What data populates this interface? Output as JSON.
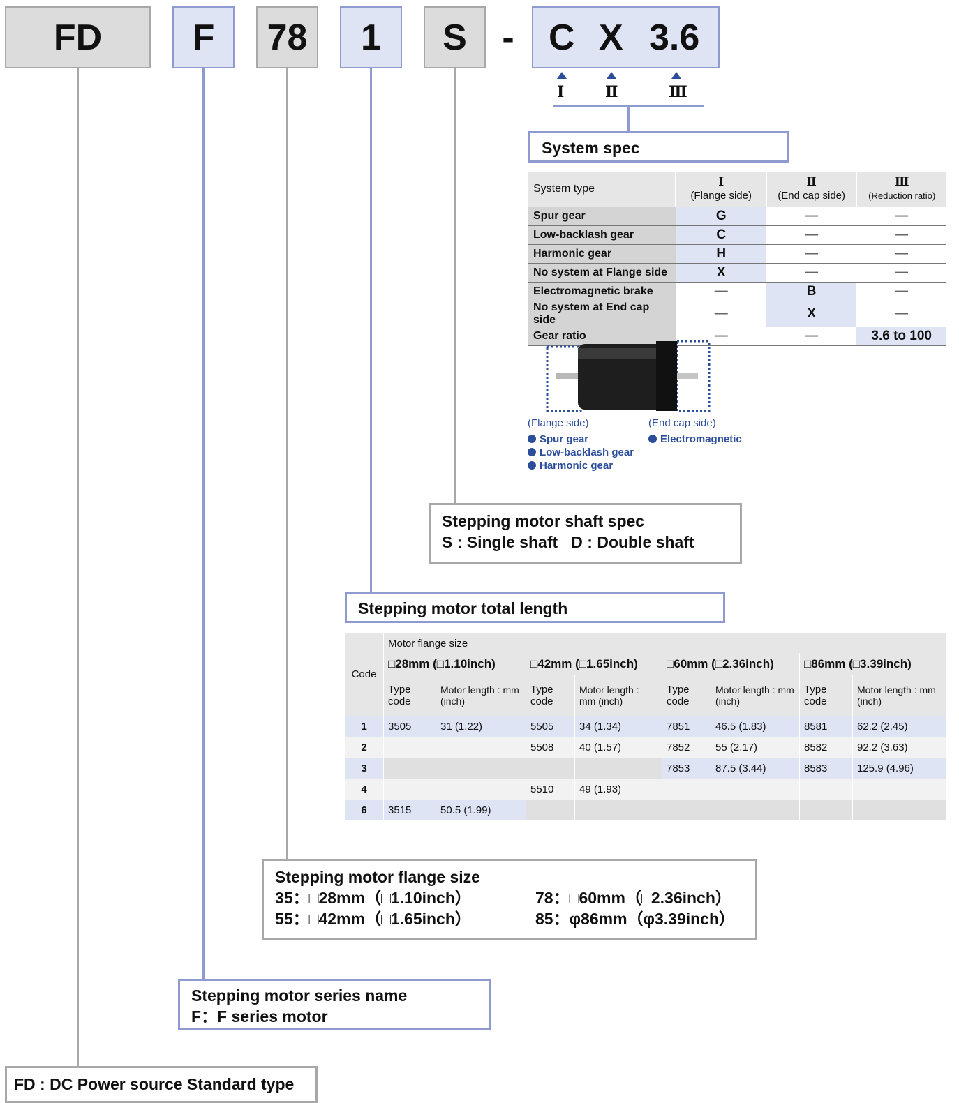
{
  "codes": {
    "fd": "FD",
    "f": "F",
    "size": "78",
    "length": "1",
    "shaft": "S",
    "dash": "-",
    "sys1": "C",
    "sys2": "X",
    "sys3": "3.6"
  },
  "roman": [
    "I",
    "Ⅱ",
    "Ⅲ"
  ],
  "system_spec": {
    "title": "System spec",
    "header": {
      "label": "System type",
      "col1": "I",
      "col1_sub": "(Flange side)",
      "col2": "Ⅱ",
      "col2_sub": "(End cap side)",
      "col3": "Ⅲ",
      "col3_sub": "(Reduction ratio)"
    },
    "rows": [
      {
        "name": "Spur gear",
        "c1": "G",
        "c2": "—",
        "c3": "—"
      },
      {
        "name": "Low-backlash gear",
        "c1": "C",
        "c2": "—",
        "c3": "—"
      },
      {
        "name": "Harmonic gear",
        "c1": "H",
        "c2": "—",
        "c3": "—"
      },
      {
        "name": "No system at Flange side",
        "c1": "X",
        "c2": "—",
        "c3": "—"
      },
      {
        "name": "Electromagnetic brake",
        "c1": "—",
        "c2": "B",
        "c3": "—"
      },
      {
        "name": "No system at End cap side",
        "c1": "—",
        "c2": "X",
        "c3": "—"
      },
      {
        "name": "Gear ratio",
        "c1": "—",
        "c2": "—",
        "c3": "3.6 to 100"
      }
    ]
  },
  "motor_caption": {
    "flange_label": "(Flange side)",
    "endcap_label": "(End cap side)",
    "flange_items": [
      "Spur gear",
      "Low-backlash gear",
      "Harmonic gear"
    ],
    "endcap_items": [
      "Electromagnetic"
    ]
  },
  "shaft_spec": {
    "title": "Stepping motor shaft spec",
    "line": "S : Single shaft   D : Double shaft"
  },
  "total_length": {
    "title": "Stepping motor total length",
    "code_label": "Code",
    "flange_label": "Motor flange size",
    "sizes": [
      "□28mm (□1.10inch)",
      "□42mm (□1.65inch)",
      "□60mm (□2.36inch)",
      "□86mm (□3.39inch)"
    ],
    "type_label": "Type code",
    "length_label": "Motor length : mm (inch)",
    "rows": [
      {
        "code": "1",
        "cells": [
          "3505",
          "31 (1.22)",
          "5505",
          "34 (1.34)",
          "7851",
          "46.5 (1.83)",
          "8581",
          "62.2 (2.45)"
        ]
      },
      {
        "code": "2",
        "cells": [
          "",
          "",
          "5508",
          "40 (1.57)",
          "7852",
          "55 (2.17)",
          "8582",
          "92.2 (3.63)"
        ]
      },
      {
        "code": "3",
        "cells": [
          "",
          "",
          "",
          "",
          "7853",
          "87.5 (3.44)",
          "8583",
          "125.9 (4.96)"
        ]
      },
      {
        "code": "4",
        "cells": [
          "",
          "",
          "5510",
          "49 (1.93)",
          "",
          "",
          "",
          ""
        ]
      },
      {
        "code": "6",
        "cells": [
          "3515",
          "50.5 (1.99)",
          "",
          "",
          "",
          "",
          "",
          ""
        ]
      }
    ]
  },
  "flange_size": {
    "title": "Stepping motor flange size",
    "items": [
      "35：□28mm（□1.10inch）",
      "78：□60mm（□2.36inch）",
      "55：□42mm（□1.65inch）",
      "85：φ86mm（φ3.39inch）"
    ]
  },
  "series": {
    "title": "Stepping motor series name",
    "line": "F：F series motor"
  },
  "fd_label": "FD : DC Power source Standard type",
  "colors": {
    "gray": "#dcdcdc",
    "blue": "#dfe4f5",
    "accent": "#2c4e9a"
  }
}
